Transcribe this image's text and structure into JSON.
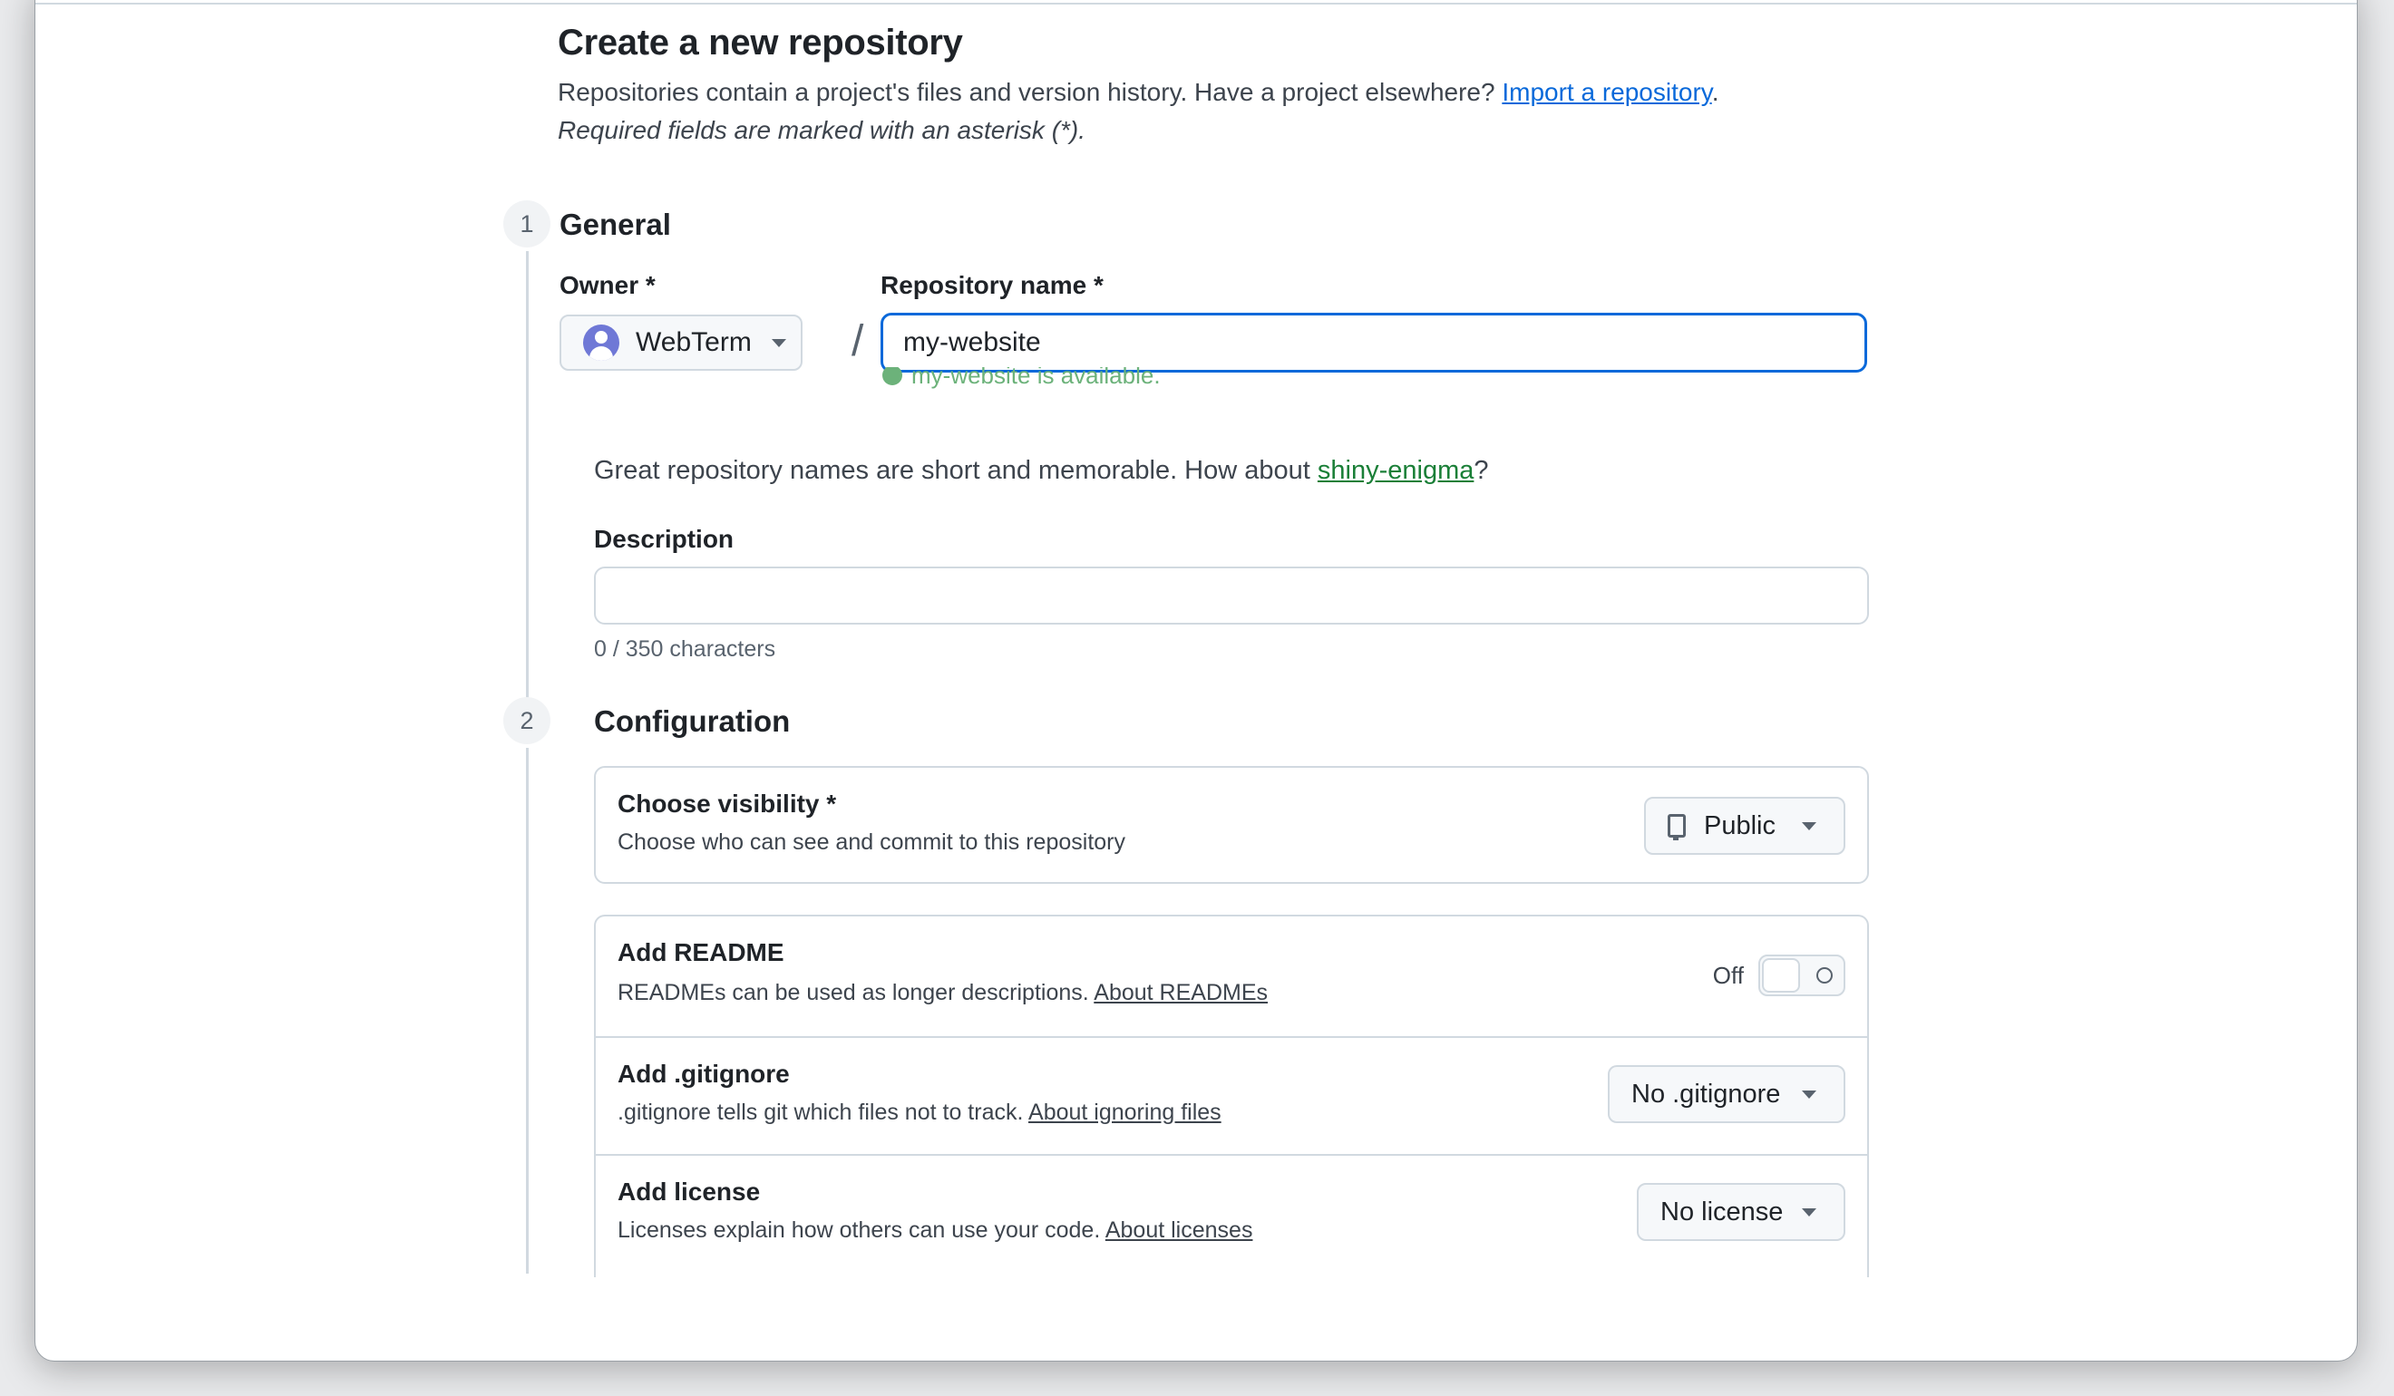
{
  "header": {
    "title": "Create a new repository",
    "lead_text": "Repositories contain a project's files and version history. Have a project elsewhere?",
    "import_link": "Import a repository",
    "lead_end": ".",
    "required_note": "Required fields are marked with an asterisk (*)."
  },
  "general": {
    "step": "1",
    "title": "General",
    "owner_label": "Owner *",
    "owner_value": "WebTerm",
    "slash": "/",
    "repo_name_label": "Repository name *",
    "repo_name_value": "my-website",
    "availability": "my-website is available.",
    "suggestion_text": "Great repository names are short and memorable. How about",
    "suggestion_name": "shiny-enigma",
    "suggestion_end": "?",
    "description_label": "Description",
    "description_value": "",
    "char_counter": "0 / 350 characters"
  },
  "configuration": {
    "step": "2",
    "title": "Configuration",
    "visibility": {
      "title": "Choose visibility *",
      "desc": "Choose who can see and commit to this repository",
      "value": "Public"
    },
    "readme": {
      "title": "Add README",
      "desc": "READMEs can be used as longer descriptions.",
      "link": "About READMEs",
      "toggle_state": "Off"
    },
    "gitignore": {
      "title": "Add .gitignore",
      "desc": ".gitignore tells git which files not to track.",
      "link": "About ignoring files",
      "value": "No .gitignore"
    },
    "license": {
      "title": "Add license",
      "desc": "Licenses explain how others can use your code.",
      "link": "About licenses",
      "value": "No license"
    }
  },
  "colors": {
    "link_blue": "#0969da",
    "focus_blue": "#0969da",
    "success_green": "#1a7f37",
    "border": "#d1d9e0"
  }
}
